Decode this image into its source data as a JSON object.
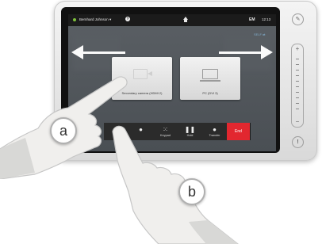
{
  "topbar": {
    "user_label": "Bernhard Johnson ▾",
    "help_glyph": "?",
    "screen_indicator": "EM",
    "time": "12:13"
  },
  "selfview_label": "SELF ⇄",
  "tiles": [
    {
      "label": "Secondary camera (HDMI 2)",
      "icon": "video-camera-icon"
    },
    {
      "label": "PC (DVI 3)",
      "icon": "laptop-icon"
    }
  ],
  "callbar": {
    "buttons": [
      {
        "label": "",
        "icon": "person-icon",
        "glyph": "●"
      },
      {
        "label": "",
        "icon": "add-person-icon",
        "glyph": "●"
      },
      {
        "label": "Keypad",
        "icon": "keypad-icon",
        "glyph": "⁙"
      },
      {
        "label": "Hold",
        "icon": "pause-icon",
        "glyph": "❚❚"
      },
      {
        "label": "Transfer",
        "icon": "transfer-icon",
        "glyph": "●"
      }
    ],
    "end_label": "End"
  },
  "side_panel": {
    "mic_glyph": "✎",
    "vol_plus": "+",
    "vol_minus": "−",
    "alert_glyph": "!"
  },
  "markers": {
    "a": "a",
    "b": "b"
  },
  "colors": {
    "end_button": "#e2272f",
    "status_dot": "#7ec13a",
    "selfview_text": "#8ec7ef"
  }
}
